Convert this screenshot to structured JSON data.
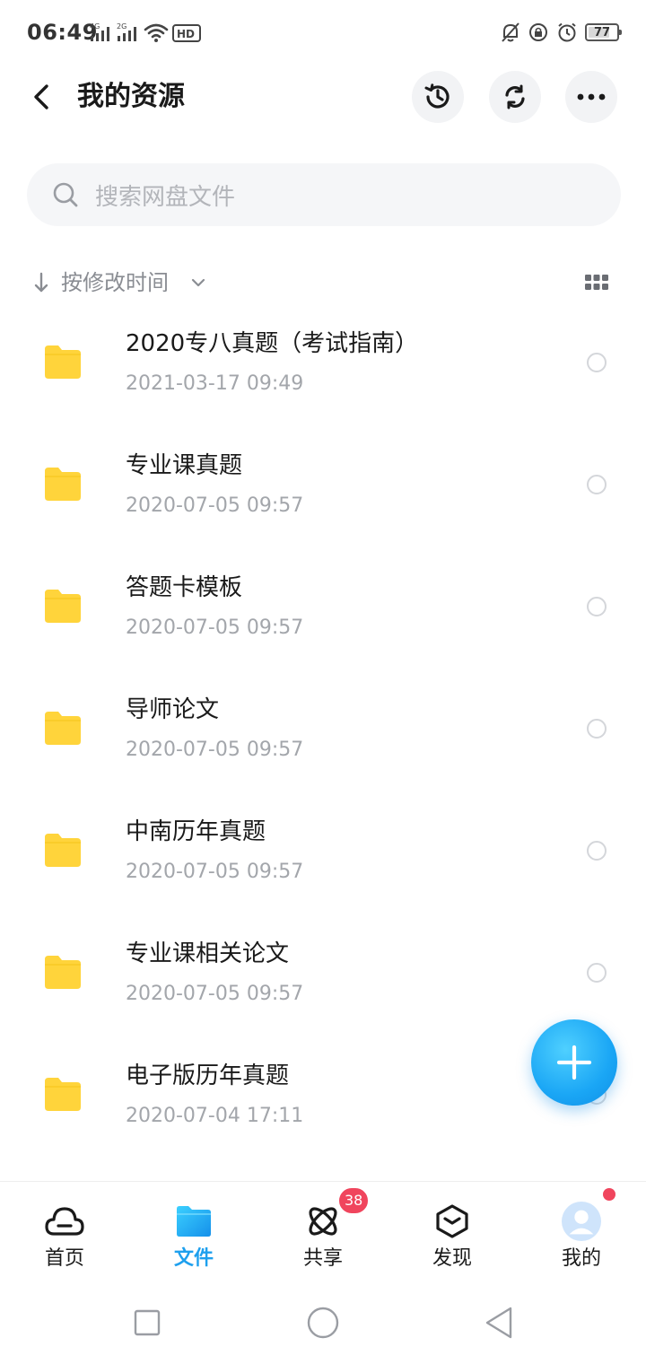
{
  "status_bar": {
    "time": "06:49",
    "network_1": "4G",
    "network_2": "2G",
    "battery": "77",
    "battery_level": 0.77
  },
  "header": {
    "title": "我的资源"
  },
  "search": {
    "placeholder": "搜索网盘文件"
  },
  "sort": {
    "label": "按修改时间"
  },
  "files": [
    {
      "name": "2020专八真题（考试指南）",
      "date": "2021-03-17  09:49"
    },
    {
      "name": "专业课真题",
      "date": "2020-07-05  09:57"
    },
    {
      "name": "答题卡模板",
      "date": "2020-07-05  09:57"
    },
    {
      "name": "导师论文",
      "date": "2020-07-05  09:57"
    },
    {
      "name": "中南历年真题",
      "date": "2020-07-05  09:57"
    },
    {
      "name": "专业课相关论文",
      "date": "2020-07-05  09:57"
    },
    {
      "name": "电子版历年真题",
      "date": "2020-07-04  17:11"
    }
  ],
  "tabs": [
    {
      "label": "首页",
      "icon": "cloud-icon"
    },
    {
      "label": "文件",
      "icon": "folder-icon"
    },
    {
      "label": "共享",
      "icon": "atom-icon"
    },
    {
      "label": "发现",
      "icon": "cube-icon"
    },
    {
      "label": "我的",
      "icon": "avatar-icon"
    }
  ],
  "share_badge": "38",
  "colors": {
    "accent": "#1ea0ee",
    "folder": "#ffd43b",
    "badge": "#f0455d"
  }
}
